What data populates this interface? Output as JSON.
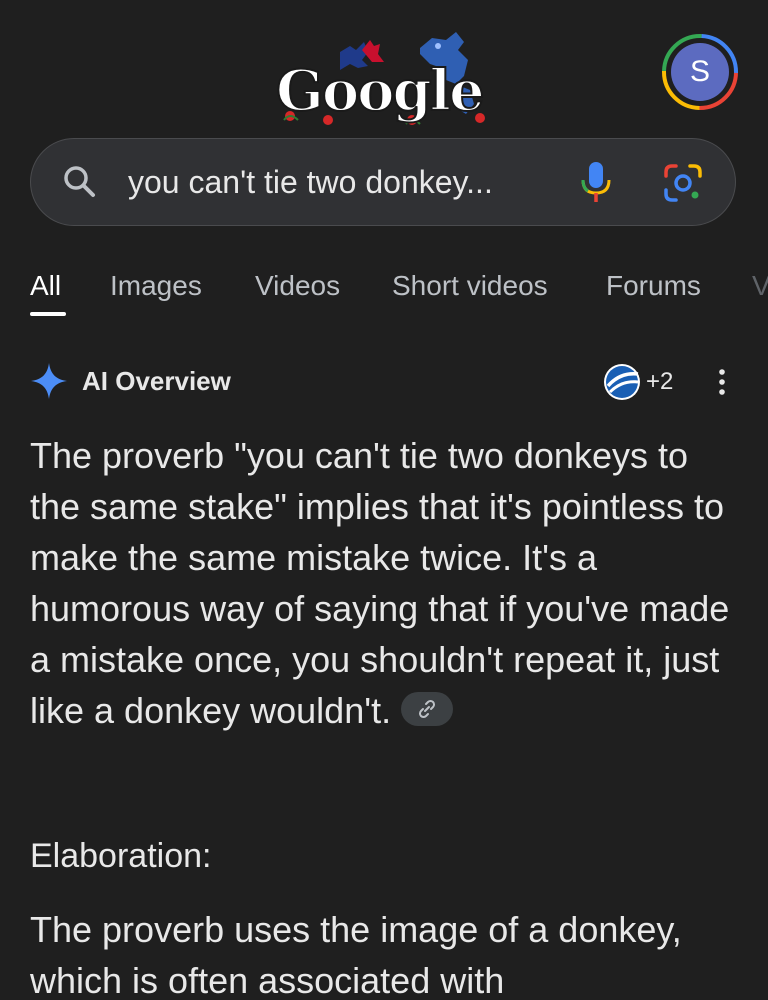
{
  "header": {
    "logo_text": "Google",
    "avatar_letter": "S"
  },
  "search": {
    "query": "you can't tie two donkey..."
  },
  "tabs": [
    {
      "label": "All",
      "active": true
    },
    {
      "label": "Images",
      "active": false
    },
    {
      "label": "Videos",
      "active": false
    },
    {
      "label": "Short videos",
      "active": false
    },
    {
      "label": "Forums",
      "active": false
    },
    {
      "label": "V",
      "active": false
    }
  ],
  "ai_overview": {
    "title": "AI Overview",
    "source_count": "+2",
    "text": "The proverb \"you can't tie two donkeys to the same stake\" implies that it's pointless to make the same mistake twice. It's a humorous way of saying that if you've made a mistake once, you shouldn't repeat it, just like a donkey wouldn't.",
    "section_heading": "Elaboration:",
    "elaboration_text": "The proverb uses the image of a donkey, which is often associated with"
  },
  "icons": {
    "search": "search-icon",
    "mic": "mic-icon",
    "lens": "lens-icon",
    "spark": "sparkle-icon",
    "source": "source-icon",
    "more": "more-vert-icon",
    "link": "link-icon"
  },
  "colors": {
    "background": "#1f1f1f",
    "search_bg": "#303134",
    "spark_blue": "#4c8df6",
    "google_blue": "#4285f4",
    "google_red": "#ea4335",
    "google_yellow": "#fbbc05",
    "google_green": "#34a853"
  }
}
